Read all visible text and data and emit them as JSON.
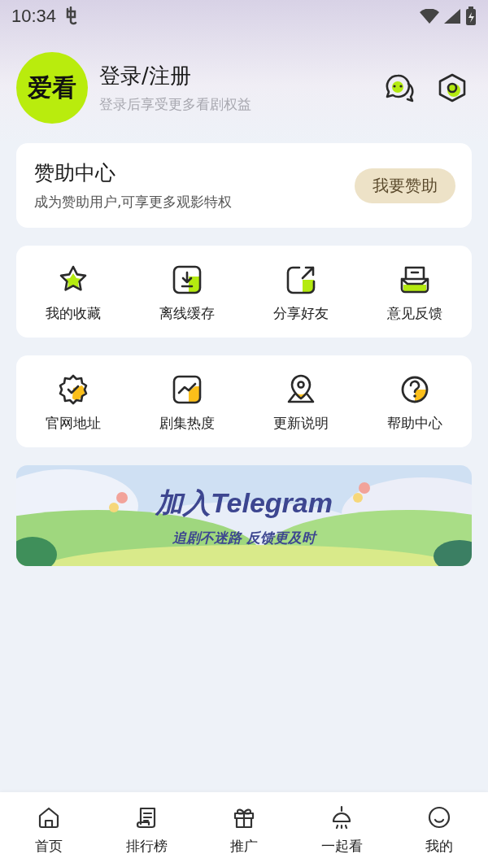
{
  "status_bar": {
    "time": "10:34"
  },
  "header": {
    "logo_text": "爱看",
    "title": "登录/注册",
    "subtitle": "登录后享受更多看剧权益"
  },
  "sponsor": {
    "title": "赞助中心",
    "description": "成为赞助用户,可享更多观影特权",
    "button": "我要赞助"
  },
  "grids": [
    {
      "items": [
        {
          "label": "我的收藏"
        },
        {
          "label": "离线缓存"
        },
        {
          "label": "分享好友"
        },
        {
          "label": "意见反馈"
        }
      ]
    },
    {
      "items": [
        {
          "label": "官网地址"
        },
        {
          "label": "剧集热度"
        },
        {
          "label": "更新说明"
        },
        {
          "label": "帮助中心"
        }
      ]
    }
  ],
  "banner": {
    "title": "加入Telegram",
    "subtitle": "追剧不迷路 反馈更及时"
  },
  "tab_bar": [
    {
      "label": "首页"
    },
    {
      "label": "排行榜"
    },
    {
      "label": "推广"
    },
    {
      "label": "一起看"
    },
    {
      "label": "我的"
    }
  ]
}
